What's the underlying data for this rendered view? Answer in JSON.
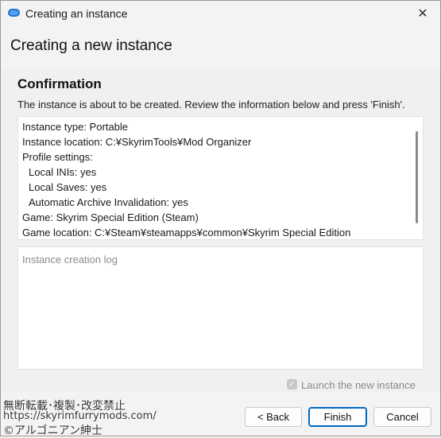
{
  "window": {
    "title": "Creating an instance",
    "close_glyph": "✕"
  },
  "header": {
    "title": "Creating a new instance"
  },
  "confirmation": {
    "title": "Confirmation",
    "description": "The instance is about to be created. Review the information below and press 'Finish'.",
    "info_lines": [
      "Instance type: Portable",
      "Instance location: C:¥SkyrimTools¥Mod Organizer",
      "Profile settings:",
      "Local INIs: yes",
      "Local Saves: yes",
      "Automatic Archive Invalidation: yes",
      "Game: Skyrim Special Edition (Steam)",
      "Game location: C:¥Steam¥steamapps¥common¥Skyrim Special Edition"
    ],
    "log_placeholder": "Instance creation log"
  },
  "launch": {
    "label": "Launch the new instance",
    "checked": true,
    "check_glyph": "✓"
  },
  "buttons": {
    "back": "< Back",
    "finish": "Finish",
    "cancel": "Cancel"
  },
  "watermark": {
    "line1": "無断転載･複製･改変禁止",
    "line2": "https://skyrimfurrymods.com/",
    "line3": "©アルゴニアン紳士"
  },
  "colors": {
    "accent": "#0067c0",
    "icon": "#1f6fd1"
  },
  "icons": {
    "app": "app-logo-icon",
    "close": "close-icon",
    "check": "checkmark-icon"
  }
}
